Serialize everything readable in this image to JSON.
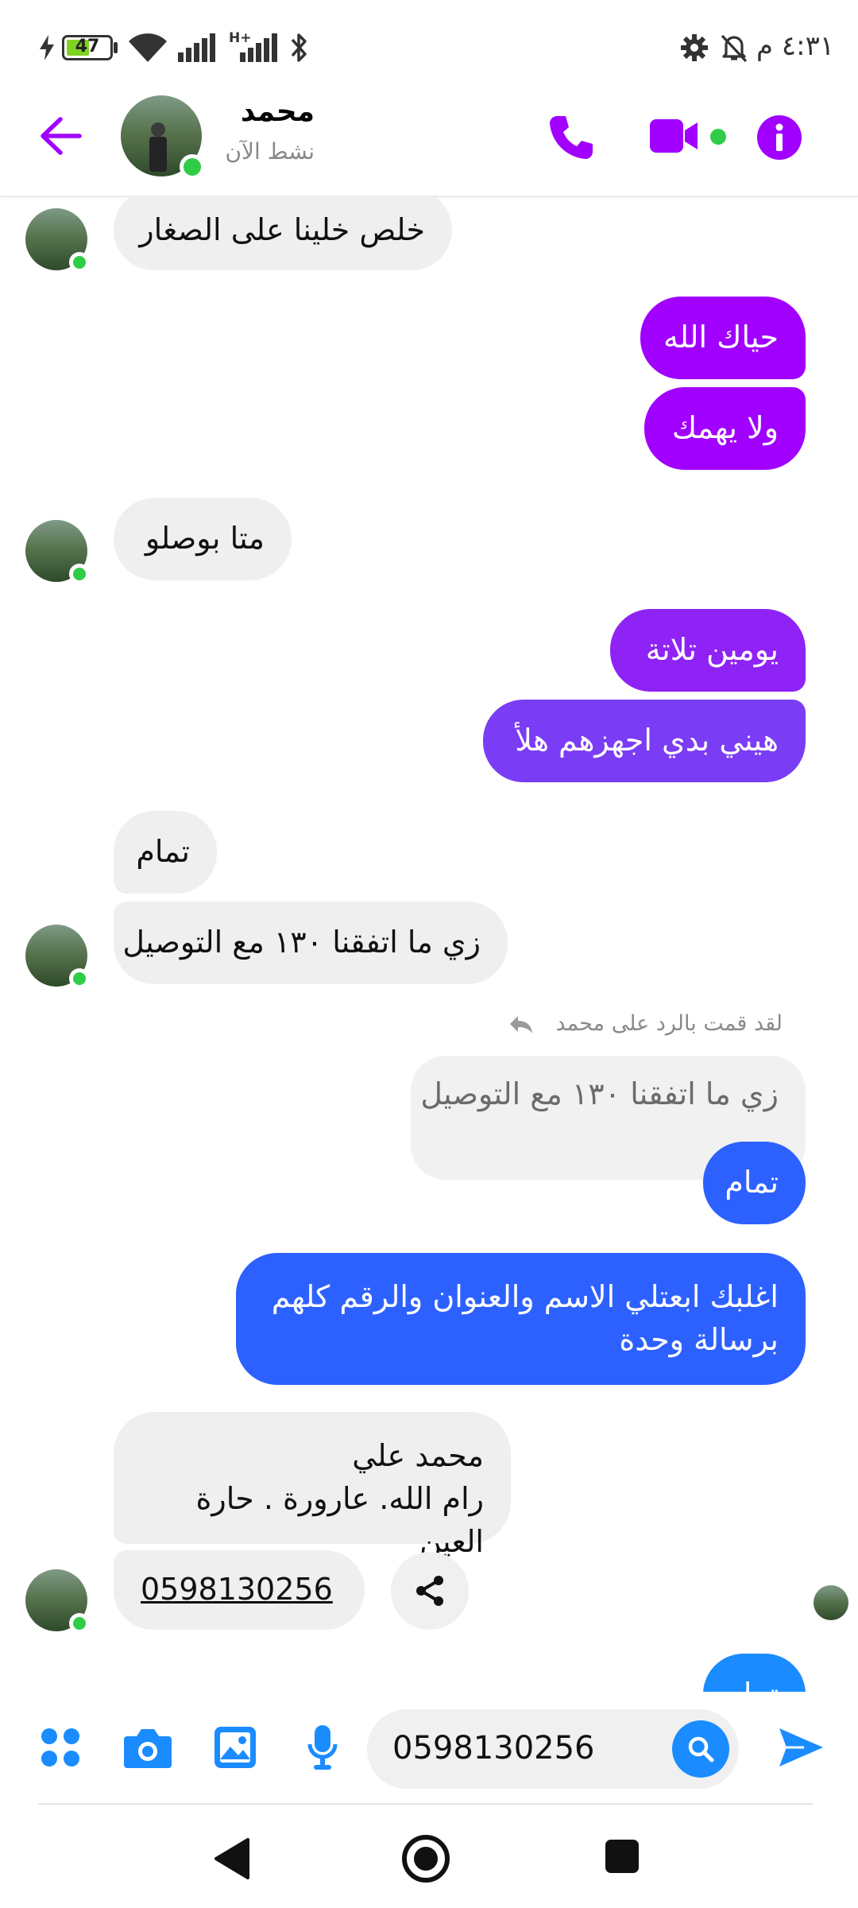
{
  "status_bar": {
    "time": "٤:٣١ م",
    "battery": "47",
    "network": "H+"
  },
  "header": {
    "contact_name": "محمد",
    "status": "نشط الآن",
    "accent": "#a100ff"
  },
  "messages": [
    {
      "dir": "in",
      "text": "خلص خلينا على الصغار"
    },
    {
      "dir": "out",
      "text": "حياك الله"
    },
    {
      "dir": "out",
      "text": "ولا يهمك"
    },
    {
      "dir": "in",
      "text": "متا بوصلو"
    },
    {
      "dir": "out",
      "text": "يومين تلاتة"
    },
    {
      "dir": "out",
      "text": "هيني بدي اجهزهم هلأ"
    },
    {
      "dir": "in",
      "text": "تمام"
    },
    {
      "dir": "in",
      "text": "زي ما اتفقنا ١٣٠ مع التوصيل"
    },
    {
      "dir": "out",
      "reply_label": "لقد قمت بالرد على محمد",
      "quoted": "زي ما اتفقنا ١٣٠ مع التوصيل",
      "text": "تمام"
    },
    {
      "dir": "out",
      "line1": "اغلبك ابعتلي الاسم والعنوان والرقم كلهم",
      "line2": "برسالة وحدة"
    },
    {
      "dir": "in",
      "line1": "محمد علي",
      "line2": "رام الله. عارورة . حارة العين"
    },
    {
      "dir": "in",
      "text": "0598130256",
      "link": true
    },
    {
      "dir": "out",
      "text": "تمام"
    }
  ],
  "composer": {
    "input_value": "0598130256"
  },
  "colors": {
    "purple": "#a100ff",
    "violet": "#8f22f5",
    "indigo": "#7a3cf4",
    "blue": "#2d61ff",
    "sky": "#1a8cff",
    "incoming": "#efefef"
  }
}
